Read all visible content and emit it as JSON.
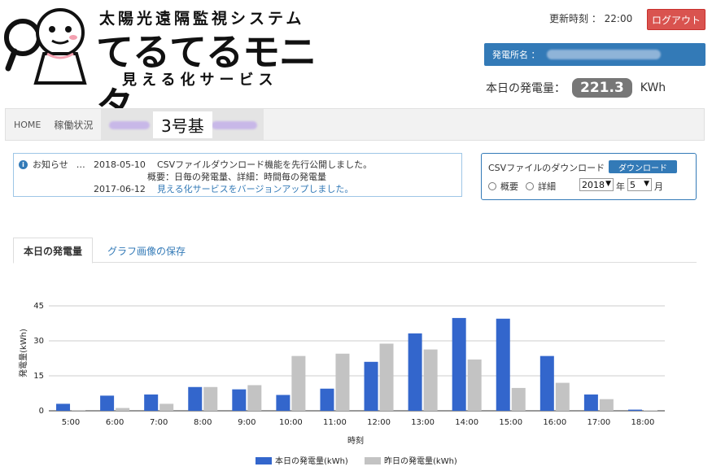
{
  "header": {
    "logo_top": "太陽光遠隔監視システム",
    "logo_main": "てるてるモニタ",
    "logo_sub": "見える化サービス",
    "updated_label": "更新時刻 ： 22:00",
    "logout_label": "ログアウト",
    "plant_label": "発電所名 ：",
    "today_label": "本日の発電量：",
    "today_value": "221.3",
    "today_unit": "KWh"
  },
  "breadcrumb": {
    "home": "HOME",
    "status": "稼働状況",
    "current": "3号基"
  },
  "news": {
    "label": "お知らせ",
    "more": "…",
    "items": [
      {
        "date": "2018-05-10",
        "text": "CSVファイルダウンロード機能を先行公開しました。"
      },
      {
        "date": "",
        "text": "概要：日毎の発電量、詳細：時間毎の発電量"
      },
      {
        "date": "2017-06-12",
        "text": "見える化サービスをバージョンアップしました。"
      }
    ]
  },
  "csv": {
    "title": "CSVファイルのダウンロード",
    "button": "ダウンロード",
    "option_summary": "概要",
    "option_detail": "詳細",
    "year": "2018",
    "year_unit": "年",
    "month": "5",
    "month_unit": "月"
  },
  "tabs": {
    "active": "本日の発電量",
    "save": "グラフ画像の保存"
  },
  "colors": {
    "today": "#3366cc",
    "yesterday": "#c3c3c3",
    "accent": "#337ab7",
    "logout": "#d9534f"
  },
  "chart_data": {
    "type": "bar",
    "categories": [
      "5:00",
      "6:00",
      "7:00",
      "8:00",
      "9:00",
      "10:00",
      "11:00",
      "12:00",
      "13:00",
      "14:00",
      "15:00",
      "16:00",
      "17:00",
      "18:00"
    ],
    "series": [
      {
        "name": "本日の発電量(kWh)",
        "values": [
          3.0,
          6.5,
          7.0,
          10.2,
          9.2,
          6.8,
          9.5,
          21.0,
          33.2,
          39.8,
          39.5,
          23.5,
          7.0,
          0.5
        ]
      },
      {
        "name": "昨日の発電量(kWh)",
        "values": [
          0.3,
          1.2,
          3.0,
          10.2,
          11.0,
          23.5,
          24.5,
          28.8,
          26.3,
          22.0,
          9.8,
          12.0,
          5.0,
          0.2
        ]
      }
    ],
    "xlabel": "時刻",
    "ylabel": "発電量(kWh)",
    "yticks": [
      0,
      15,
      30,
      45
    ],
    "ylim": [
      0,
      45
    ],
    "grid": true,
    "legend": "bottom"
  }
}
